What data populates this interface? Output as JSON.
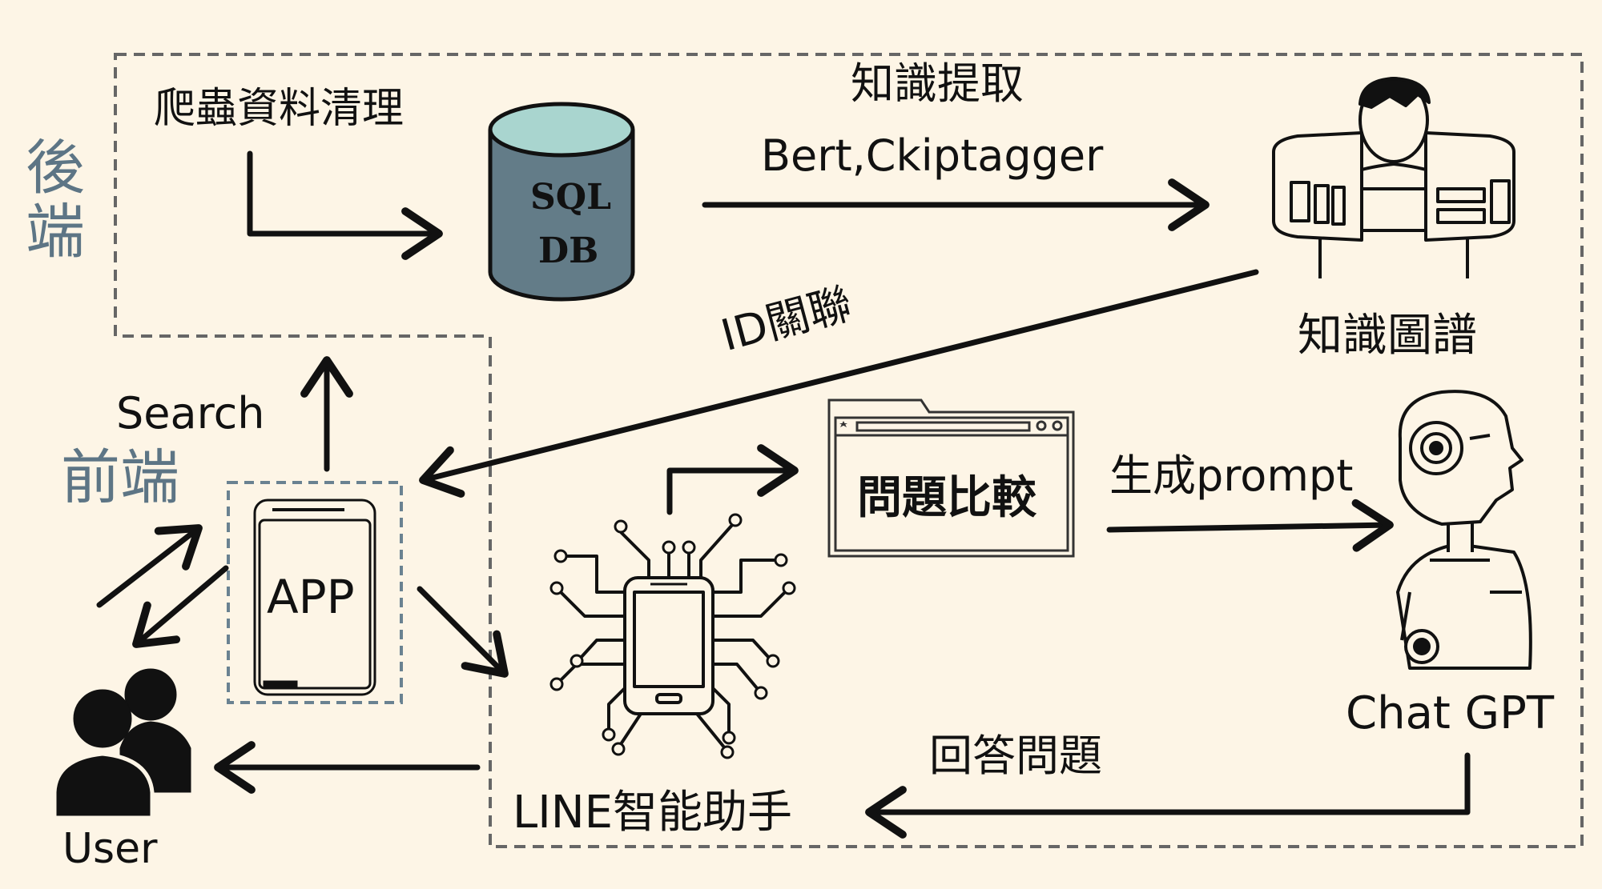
{
  "sections": {
    "backend": "後端",
    "frontend": "前端"
  },
  "labels": {
    "crawler": "爬蟲資料清理",
    "db_line1": "SQL",
    "db_line2": "DB",
    "extraction_title": "知識提取",
    "extraction_tools": "Bert,Ckiptagger",
    "knowledge_graph": "知識圖譜",
    "id_link": "ID關聯",
    "search": "Search",
    "app": "APP",
    "compare": "問題比較",
    "generate_prompt": "生成prompt",
    "chatgpt": "Chat GPT",
    "answer": "回答問題",
    "line_assistant": "LINE智能助手",
    "user": "User"
  },
  "colors": {
    "background": "#fdf5e6",
    "db_body": "#637c88",
    "db_top": "#a9d5cf",
    "section_text": "#5d7585",
    "line": "#111111"
  },
  "icons": [
    "database-icon",
    "knowledge-graph-person-icon",
    "robot-head-icon",
    "smartphone-circuit-icon",
    "browser-window-icon",
    "user-group-icon",
    "mobile-app-icon"
  ]
}
